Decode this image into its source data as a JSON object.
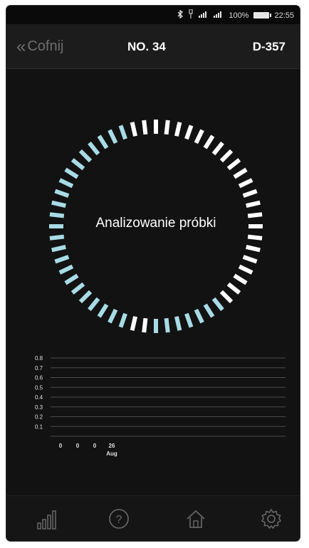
{
  "status_bar": {
    "battery_text": "100%",
    "time": "22:55",
    "icons": [
      "bluetooth-icon",
      "usb-icon",
      "signal-icon",
      "signal-icon",
      "battery-icon"
    ]
  },
  "nav": {
    "back_label": "Cofnij",
    "title": "NO. 34",
    "device_id": "D-357"
  },
  "progress_ring": {
    "label": "Analizowanie próbki",
    "accent_color": "#a8dbe6",
    "inactive_color": "#ffffff"
  },
  "chart_data": {
    "type": "bar",
    "y_ticks": [
      "0.8",
      "0.7",
      "0.6",
      "0.5",
      "0.4",
      "0.3",
      "0.2",
      "0.1"
    ],
    "ylim": [
      0,
      0.8
    ],
    "categories": [
      "0",
      "0",
      "0",
      "26\nAug"
    ],
    "x_labels": [
      "0",
      "0",
      "0",
      "26"
    ],
    "x_sublabel": "Aug",
    "values": [
      0,
      0,
      0,
      0
    ],
    "grid": true
  },
  "tabbar": {
    "items": [
      {
        "name": "stats",
        "icon": "bar-chart-icon"
      },
      {
        "name": "help",
        "icon": "help-icon"
      },
      {
        "name": "home",
        "icon": "home-icon"
      },
      {
        "name": "settings",
        "icon": "gear-icon"
      }
    ],
    "icon_color": "#6a6a6a"
  }
}
